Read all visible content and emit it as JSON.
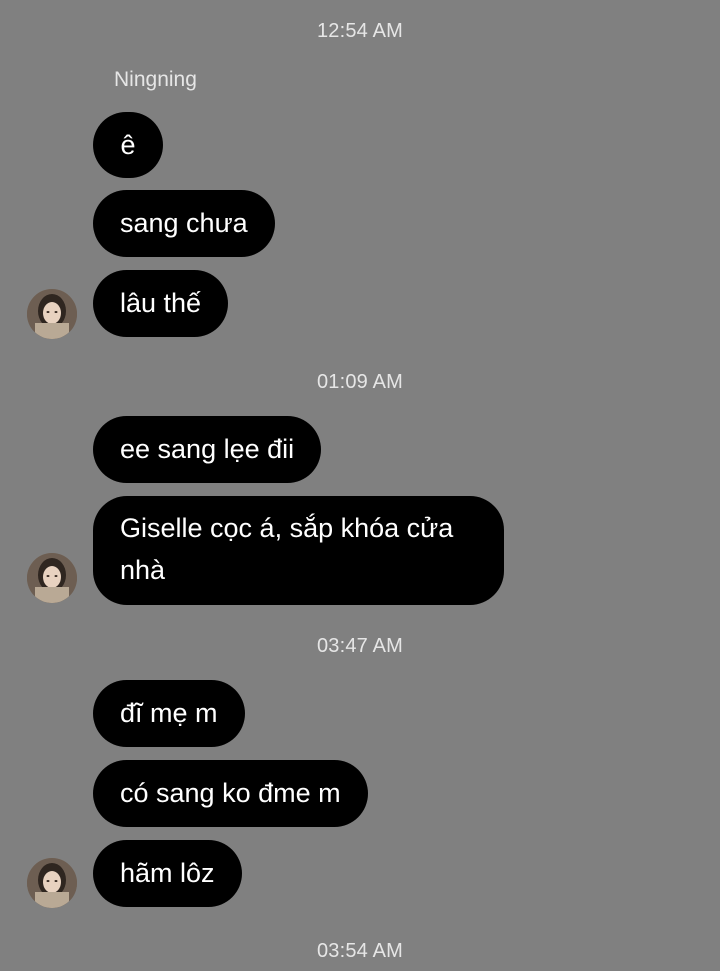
{
  "chat": {
    "timestamps": [
      "12:54 AM",
      "01:09 AM",
      "03:47 AM",
      "03:54 AM"
    ],
    "sender_name": "Ningning",
    "messages": [
      {
        "text": "ê"
      },
      {
        "text": "sang chưa"
      },
      {
        "text": "lâu thế"
      },
      {
        "text": "ee sang lẹe đii"
      },
      {
        "text": "Giselle cọc á, sắp khóa cửa nhà"
      },
      {
        "text": "đĩ mẹ m"
      },
      {
        "text": "có sang ko đme m"
      },
      {
        "text": "hãm lôz"
      }
    ]
  }
}
